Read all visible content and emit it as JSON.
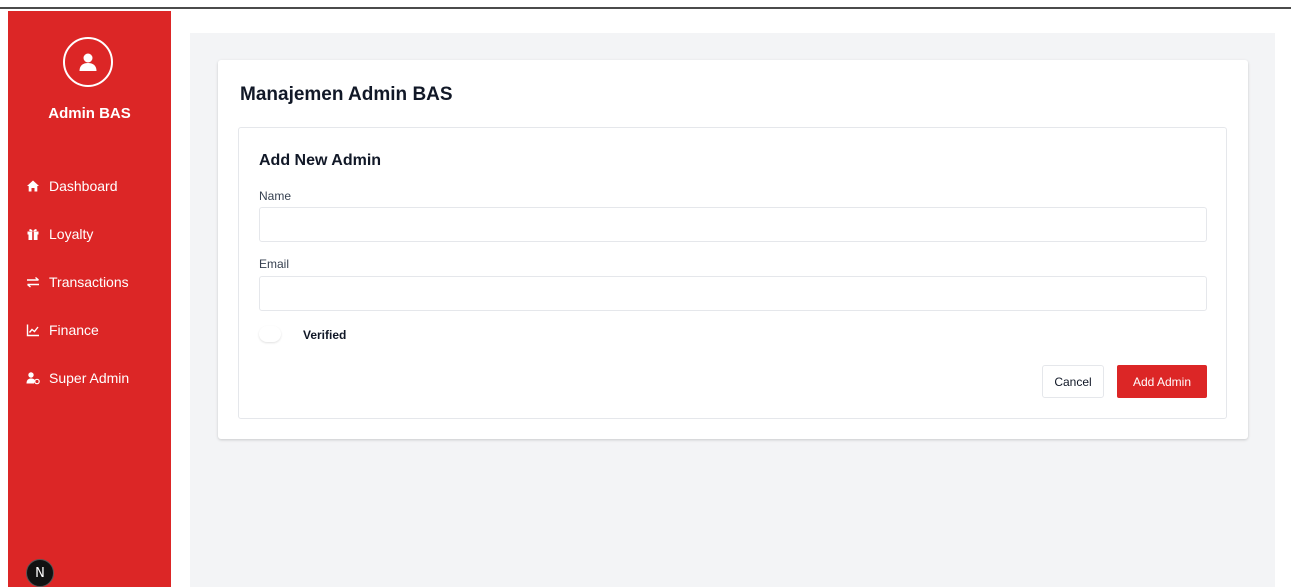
{
  "sidebar": {
    "brand": "Admin BAS",
    "avatar_icon": "user-icon",
    "items": [
      {
        "label": "Dashboard",
        "icon": "home-icon"
      },
      {
        "label": "Loyalty",
        "icon": "gift-icon"
      },
      {
        "label": "Transactions",
        "icon": "exchange-icon"
      },
      {
        "label": "Finance",
        "icon": "chart-line-icon"
      },
      {
        "label": "Super Admin",
        "icon": "user-gear-icon"
      }
    ],
    "badge": "N"
  },
  "page": {
    "title": "Manajemen Admin BAS"
  },
  "form": {
    "title": "Add New Admin",
    "name_label": "Name",
    "name_value": "",
    "email_label": "Email",
    "email_value": "",
    "verified_label": "Verified",
    "cancel_label": "Cancel",
    "submit_label": "Add Admin"
  },
  "colors": {
    "accent": "#dc2626",
    "background": "#f3f4f6"
  }
}
